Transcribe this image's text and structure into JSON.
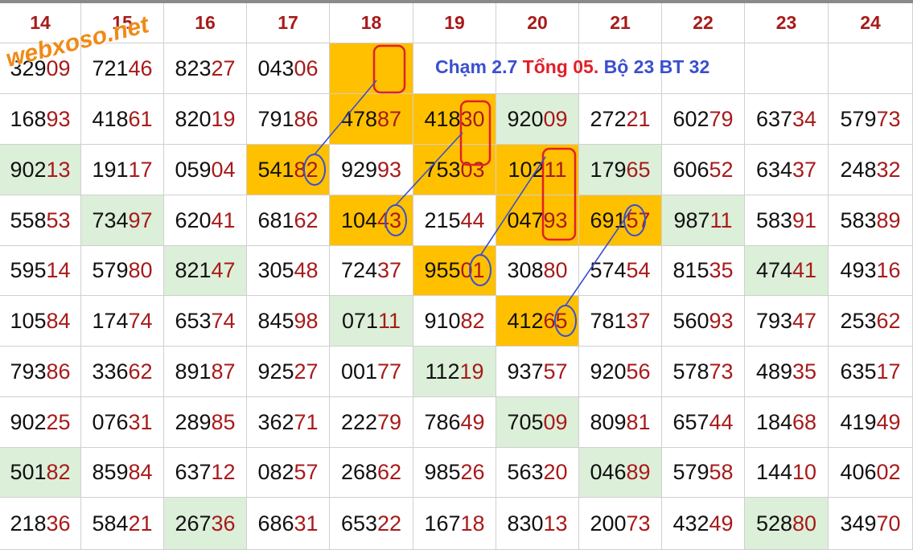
{
  "headers": [
    "14",
    "15",
    "16",
    "17",
    "18",
    "19",
    "20",
    "21",
    "22",
    "23",
    "24"
  ],
  "rows": [
    [
      "32909",
      "72146",
      "82327",
      "04306",
      "",
      "",
      "",
      "",
      "",
      "",
      ""
    ],
    [
      "16893",
      "41861",
      "82019",
      "79186",
      "47887",
      "41830",
      "92009",
      "27221",
      "60279",
      "63734",
      "57973"
    ],
    [
      "90213",
      "19117",
      "05904",
      "54182",
      "92993",
      "75303",
      "10211",
      "17965",
      "60652",
      "63437",
      "24832"
    ],
    [
      "55853",
      "73497",
      "62041",
      "68162",
      "10443",
      "21544",
      "04793",
      "69157",
      "98711",
      "58391",
      "58389"
    ],
    [
      "59514",
      "57980",
      "82147",
      "30548",
      "72437",
      "95501",
      "30880",
      "57454",
      "81535",
      "47441",
      "49316"
    ],
    [
      "10584",
      "17474",
      "65374",
      "84598",
      "07111",
      "91082",
      "41265",
      "78137",
      "56093",
      "79347",
      "25362"
    ],
    [
      "79386",
      "33662",
      "89187",
      "92527",
      "00177",
      "11219",
      "93757",
      "92056",
      "57873",
      "48935",
      "63517"
    ],
    [
      "90225",
      "07631",
      "28985",
      "36271",
      "22279",
      "78649",
      "70509",
      "80981",
      "65744",
      "18468",
      "41949"
    ],
    [
      "50182",
      "85984",
      "63712",
      "08257",
      "26862",
      "98526",
      "56320",
      "04689",
      "57958",
      "14410",
      "40602"
    ],
    [
      "21836",
      "58421",
      "26736",
      "68631",
      "65322",
      "16718",
      "83013",
      "20073",
      "43249",
      "52880",
      "34970"
    ]
  ],
  "cell_styles": [
    [
      "",
      "",
      "",
      "",
      "orange",
      "",
      "",
      "",
      "",
      "",
      ""
    ],
    [
      "",
      "",
      "",
      "",
      "orange",
      "orange",
      "green",
      "",
      "",
      "",
      ""
    ],
    [
      "green",
      "",
      "",
      "orange",
      "",
      "orange",
      "orange",
      "green",
      "",
      "",
      ""
    ],
    [
      "",
      "green",
      "",
      "",
      "orange",
      "",
      "orange",
      "orange",
      "green",
      "",
      ""
    ],
    [
      "",
      "",
      "green",
      "",
      "",
      "orange",
      "",
      "",
      "",
      "green",
      ""
    ],
    [
      "",
      "",
      "",
      "",
      "green",
      "",
      "orange",
      "",
      "",
      "",
      ""
    ],
    [
      "",
      "",
      "",
      "",
      "",
      "green",
      "",
      "",
      "",
      "",
      ""
    ],
    [
      "",
      "",
      "",
      "",
      "",
      "",
      "green",
      "",
      "",
      "",
      ""
    ],
    [
      "green",
      "",
      "",
      "",
      "",
      "",
      "",
      "green",
      "",
      "",
      ""
    ],
    [
      "",
      "",
      "green",
      "",
      "",
      "",
      "",
      "",
      "",
      "green",
      ""
    ]
  ],
  "note": {
    "part1": "Chạm 2.7",
    "part2": "Tổng 05.",
    "part3": "Bộ 23 BT 32"
  },
  "watermark": "webxoso.net",
  "colors": {
    "orange": "#ffc000",
    "green": "#dcefd9",
    "highlight_digits": "#a81a1a",
    "header_text": "#a81a1a",
    "note_blue": "#3a4fd0",
    "note_red": "#e0202a",
    "watermark": "#f08a16",
    "mark_red": "#e0202a",
    "mark_blue": "#3a4fd0"
  },
  "red_boxes": [
    {
      "row": 0,
      "col": 4,
      "digits": "pair"
    },
    {
      "row": 1,
      "col": 5,
      "digits": "pair"
    },
    {
      "row": 2,
      "col": 5,
      "digits": "pair"
    },
    {
      "row": 2,
      "col": 6,
      "digits": "pair"
    },
    {
      "row": 3,
      "col": 6,
      "digits": "pair"
    }
  ],
  "blue_circles": [
    {
      "row": 2,
      "col": 3
    },
    {
      "row": 3,
      "col": 4
    },
    {
      "row": 4,
      "col": 5
    },
    {
      "row": 5,
      "col": 6
    },
    {
      "row": 3,
      "col": 7
    }
  ]
}
